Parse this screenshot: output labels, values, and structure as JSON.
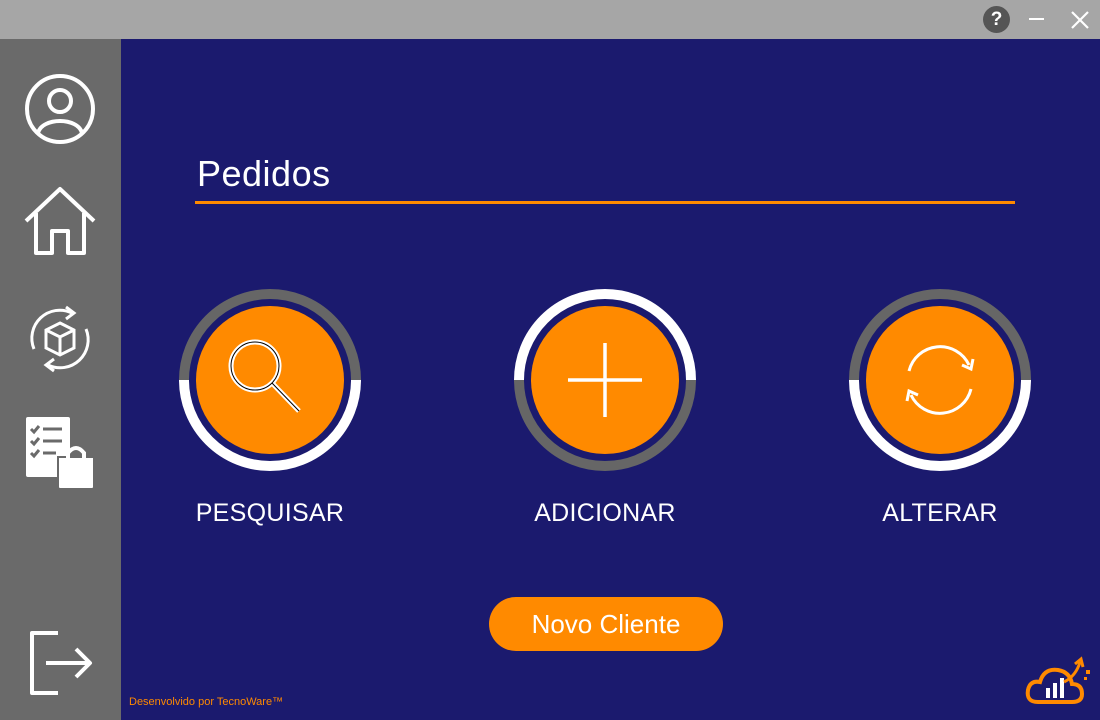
{
  "window": {
    "help_label": "?"
  },
  "sidebar": {
    "items": [
      {
        "name": "user-profile",
        "icon": "user-circle-icon"
      },
      {
        "name": "home",
        "icon": "home-icon"
      },
      {
        "name": "products",
        "icon": "box-refresh-icon"
      },
      {
        "name": "orders",
        "icon": "checklist-bag-icon"
      },
      {
        "name": "logout",
        "icon": "logout-icon"
      }
    ]
  },
  "main": {
    "title": "Pedidos",
    "actions": [
      {
        "label": "PESQUISAR",
        "icon": "search-icon"
      },
      {
        "label": "ADICIONAR",
        "icon": "plus-icon"
      },
      {
        "label": "ALTERAR",
        "icon": "refresh-icon"
      }
    ],
    "novo_cliente_label": "Novo Cliente",
    "footer": "Desenvolvido por TecnoWare™"
  },
  "colors": {
    "background": "#1b1a6e",
    "accent": "#ff8a00",
    "sidebar": "#6a6a6a",
    "titlebar": "#a6a6a6"
  }
}
